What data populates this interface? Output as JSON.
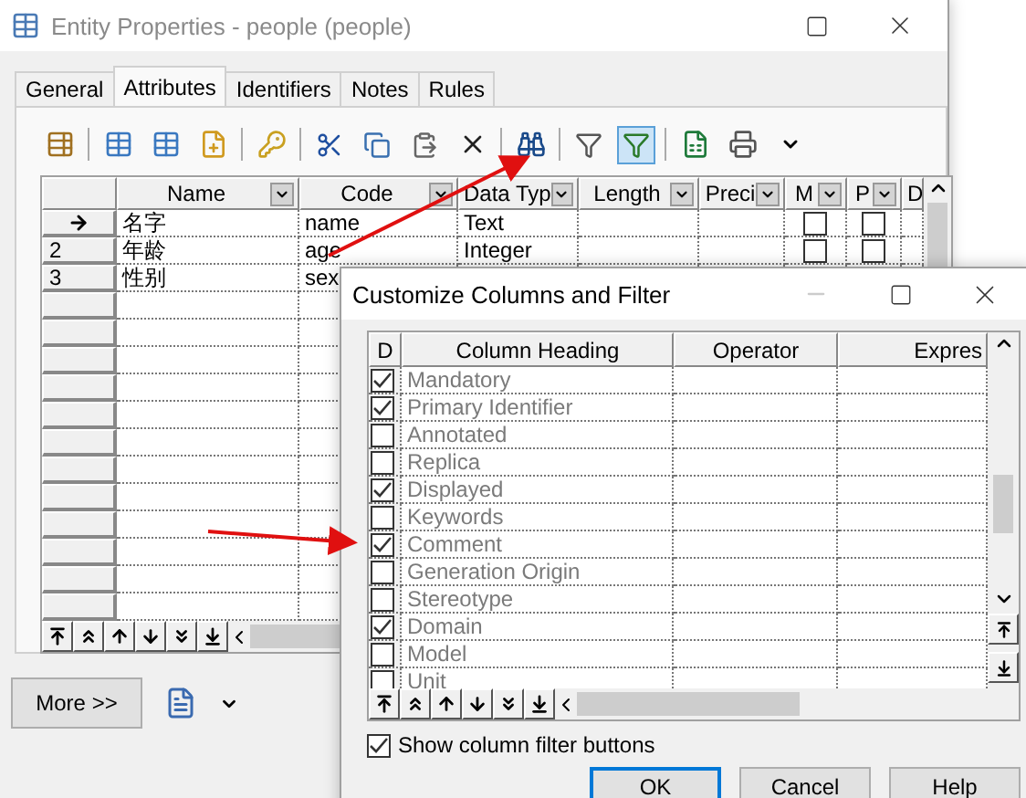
{
  "main_window": {
    "title": "Entity Properties - people (people)",
    "tabs": [
      {
        "label": "General",
        "selected": false
      },
      {
        "label": "Attributes",
        "selected": true
      },
      {
        "label": "Identifiers",
        "selected": false
      },
      {
        "label": "Notes",
        "selected": false
      },
      {
        "label": "Rules",
        "selected": false
      }
    ],
    "toolbar": {
      "filter_pressed": true
    },
    "grid": {
      "columns": [
        "Name",
        "Code",
        "Data Typ",
        "Length",
        "Preci",
        "M",
        "P",
        "D"
      ],
      "rows": [
        {
          "number": "",
          "current": true,
          "name": "名字",
          "code": "name",
          "data_type": "Text",
          "mandatory": false,
          "primary": false
        },
        {
          "number": "2",
          "current": false,
          "name": "年龄",
          "code": "age",
          "data_type": "Integer",
          "mandatory": false,
          "primary": false
        },
        {
          "number": "3",
          "current": false,
          "name": "性别",
          "code": "sex"
        }
      ]
    },
    "more_button": "More >>"
  },
  "dialog": {
    "title": "Customize Columns and Filter",
    "columns": [
      "D",
      "Column Heading",
      "Operator",
      "Expres"
    ],
    "rows": [
      {
        "heading": "Mandatory",
        "checked": true
      },
      {
        "heading": "Primary Identifier",
        "checked": true
      },
      {
        "heading": "Annotated",
        "checked": false
      },
      {
        "heading": "Replica",
        "checked": false
      },
      {
        "heading": "Displayed",
        "checked": true
      },
      {
        "heading": "Keywords",
        "checked": false
      },
      {
        "heading": "Comment",
        "checked": true
      },
      {
        "heading": "Generation Origin",
        "checked": false
      },
      {
        "heading": "Stereotype",
        "checked": false
      },
      {
        "heading": "Domain",
        "checked": true
      },
      {
        "heading": "Model",
        "checked": false
      },
      {
        "heading": "Unit",
        "checked": false
      }
    ],
    "show_filter_buttons": {
      "label": "Show column filter buttons",
      "checked": true
    },
    "buttons": [
      {
        "label": "OK",
        "default": true
      },
      {
        "label": "Cancel",
        "default": false
      },
      {
        "label": "Help",
        "default": false
      }
    ]
  }
}
